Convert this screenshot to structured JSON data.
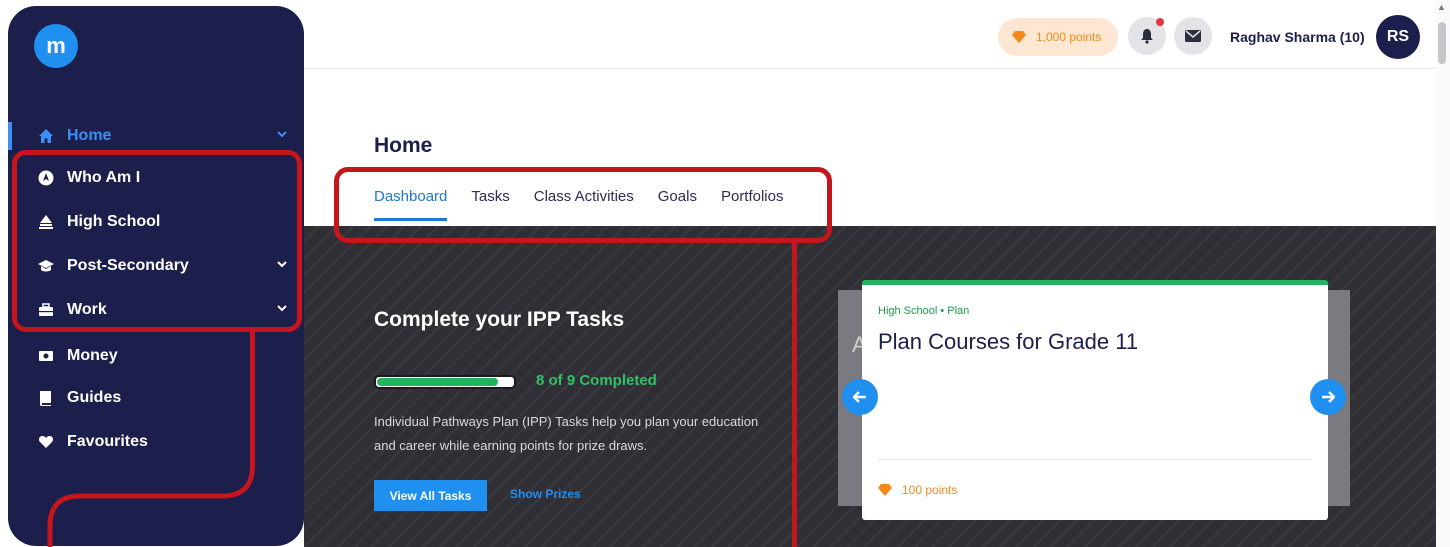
{
  "sidebar": {
    "logo": "m",
    "items": [
      {
        "label": "Home",
        "icon": "home-icon",
        "has_chevron": true,
        "active": true
      },
      {
        "label": "Who Am I",
        "icon": "compass-icon",
        "has_chevron": false
      },
      {
        "label": "High School",
        "icon": "school-icon",
        "has_chevron": false
      },
      {
        "label": "Post-Secondary",
        "icon": "graduation-cap-icon",
        "has_chevron": true
      },
      {
        "label": "Work",
        "icon": "briefcase-icon",
        "has_chevron": true
      },
      {
        "label": "Money",
        "icon": "money-icon",
        "has_chevron": false
      },
      {
        "label": "Guides",
        "icon": "book-icon",
        "has_chevron": false
      },
      {
        "label": "Favourites",
        "icon": "heart-icon",
        "has_chevron": false
      }
    ]
  },
  "header": {
    "points": "1,000 points",
    "user_name": "Raghav Sharma (10)",
    "avatar_initials": "RS"
  },
  "main": {
    "title": "Home",
    "tabs": [
      {
        "label": "Dashboard",
        "active": true
      },
      {
        "label": "Tasks"
      },
      {
        "label": "Class Activities"
      },
      {
        "label": "Goals"
      },
      {
        "label": "Portfolios"
      }
    ]
  },
  "ipp": {
    "title": "Complete your IPP Tasks",
    "completed": 8,
    "total": 9,
    "progress_text": "8 of 9 Completed",
    "description": "Individual Pathways Plan (IPP) Tasks help you plan your education and career while earning points for prize draws.",
    "primary_button": "View All Tasks",
    "link_button": "Show Prizes"
  },
  "task_card": {
    "eyebrow": "High School • Plan",
    "title": "Plan Courses for Grade 11",
    "points": "100 points"
  },
  "colors": {
    "sidebar_bg": "#1c1e4b",
    "accent_blue": "#1f8ff0",
    "success_green": "#23b35f",
    "points_orange": "#f28a1a",
    "annotation_red": "#c4161c"
  }
}
